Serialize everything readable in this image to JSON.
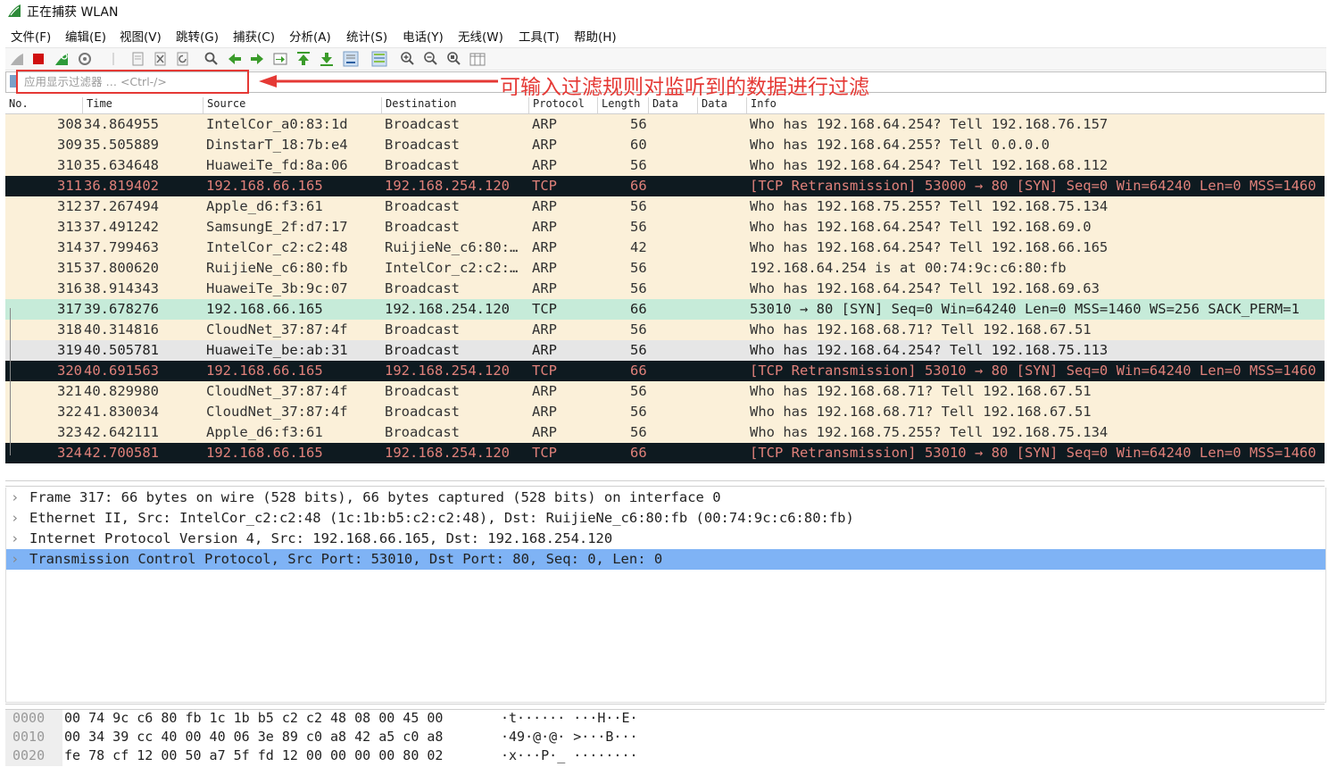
{
  "window": {
    "title": "正在捕获 WLAN"
  },
  "menu": [
    "文件(F)",
    "编辑(E)",
    "视图(V)",
    "跳转(G)",
    "捕获(C)",
    "分析(A)",
    "统计(S)",
    "电话(Y)",
    "无线(W)",
    "工具(T)",
    "帮助(H)"
  ],
  "filter": {
    "placeholder": "应用显示过滤器 … <Ctrl-/>"
  },
  "annotation": "可输入过滤规则对监听到的数据进行过滤",
  "columns": {
    "no": "No.",
    "time": "Time",
    "source": "Source",
    "destination": "Destination",
    "protocol": "Protocol",
    "length": "Length",
    "data1": "Data",
    "data2": "Data",
    "info": "Info"
  },
  "packets": [
    {
      "no": "308",
      "time": "34.864955",
      "src": "IntelCor_a0:83:1d",
      "dst": "Broadcast",
      "proto": "ARP",
      "len": "56",
      "info": "Who has 192.168.64.254? Tell 192.168.76.157",
      "style": "arp"
    },
    {
      "no": "309",
      "time": "35.505889",
      "src": "DinstarT_18:7b:e4",
      "dst": "Broadcast",
      "proto": "ARP",
      "len": "60",
      "info": "Who has 192.168.64.255? Tell 0.0.0.0",
      "style": "arp"
    },
    {
      "no": "310",
      "time": "35.634648",
      "src": "HuaweiTe_fd:8a:06",
      "dst": "Broadcast",
      "proto": "ARP",
      "len": "56",
      "info": "Who has 192.168.64.254? Tell 192.168.68.112",
      "style": "arp"
    },
    {
      "no": "311",
      "time": "36.819402",
      "src": "192.168.66.165",
      "dst": "192.168.254.120",
      "proto": "TCP",
      "len": "66",
      "info": "[TCP Retransmission] 53000 → 80 [SYN] Seq=0 Win=64240 Len=0 MSS=1460",
      "style": "tcpbad"
    },
    {
      "no": "312",
      "time": "37.267494",
      "src": "Apple_d6:f3:61",
      "dst": "Broadcast",
      "proto": "ARP",
      "len": "56",
      "info": "Who has 192.168.75.255? Tell 192.168.75.134",
      "style": "arp"
    },
    {
      "no": "313",
      "time": "37.491242",
      "src": "SamsungE_2f:d7:17",
      "dst": "Broadcast",
      "proto": "ARP",
      "len": "56",
      "info": "Who has 192.168.64.254? Tell 192.168.69.0",
      "style": "arp"
    },
    {
      "no": "314",
      "time": "37.799463",
      "src": "IntelCor_c2:c2:48",
      "dst": "RuijieNe_c6:80:…",
      "proto": "ARP",
      "len": "42",
      "info": "Who has 192.168.64.254? Tell 192.168.66.165",
      "style": "arp"
    },
    {
      "no": "315",
      "time": "37.800620",
      "src": "RuijieNe_c6:80:fb",
      "dst": "IntelCor_c2:c2:…",
      "proto": "ARP",
      "len": "56",
      "info": "192.168.64.254 is at 00:74:9c:c6:80:fb",
      "style": "arp"
    },
    {
      "no": "316",
      "time": "38.914343",
      "src": "HuaweiTe_3b:9c:07",
      "dst": "Broadcast",
      "proto": "ARP",
      "len": "56",
      "info": "Who has 192.168.64.254? Tell 192.168.69.63",
      "style": "arp"
    },
    {
      "no": "317",
      "time": "39.678276",
      "src": "192.168.66.165",
      "dst": "192.168.254.120",
      "proto": "TCP",
      "len": "66",
      "info": "53010 → 80 [SYN] Seq=0 Win=64240 Len=0 MSS=1460 WS=256 SACK_PERM=1",
      "style": "tcp"
    },
    {
      "no": "318",
      "time": "40.314816",
      "src": "CloudNet_37:87:4f",
      "dst": "Broadcast",
      "proto": "ARP",
      "len": "56",
      "info": "Who has 192.168.68.71? Tell 192.168.67.51",
      "style": "arp"
    },
    {
      "no": "319",
      "time": "40.505781",
      "src": "HuaweiTe_be:ab:31",
      "dst": "Broadcast",
      "proto": "ARP",
      "len": "56",
      "info": "Who has 192.168.64.254? Tell 192.168.75.113",
      "style": "grey"
    },
    {
      "no": "320",
      "time": "40.691563",
      "src": "192.168.66.165",
      "dst": "192.168.254.120",
      "proto": "TCP",
      "len": "66",
      "info": "[TCP Retransmission] 53010 → 80 [SYN] Seq=0 Win=64240 Len=0 MSS=1460",
      "style": "tcpbad"
    },
    {
      "no": "321",
      "time": "40.829980",
      "src": "CloudNet_37:87:4f",
      "dst": "Broadcast",
      "proto": "ARP",
      "len": "56",
      "info": "Who has 192.168.68.71? Tell 192.168.67.51",
      "style": "arp"
    },
    {
      "no": "322",
      "time": "41.830034",
      "src": "CloudNet_37:87:4f",
      "dst": "Broadcast",
      "proto": "ARP",
      "len": "56",
      "info": "Who has 192.168.68.71? Tell 192.168.67.51",
      "style": "arp"
    },
    {
      "no": "323",
      "time": "42.642111",
      "src": "Apple_d6:f3:61",
      "dst": "Broadcast",
      "proto": "ARP",
      "len": "56",
      "info": "Who has 192.168.75.255? Tell 192.168.75.134",
      "style": "arp"
    },
    {
      "no": "324",
      "time": "42.700581",
      "src": "192.168.66.165",
      "dst": "192.168.254.120",
      "proto": "TCP",
      "len": "66",
      "info": "[TCP Retransmission] 53010 → 80 [SYN] Seq=0 Win=64240 Len=0 MSS=1460",
      "style": "tcpbad"
    }
  ],
  "details": [
    {
      "text": "Frame 317: 66 bytes on wire (528 bits), 66 bytes captured (528 bits) on interface 0",
      "selected": false
    },
    {
      "text": "Ethernet II, Src: IntelCor_c2:c2:48 (1c:1b:b5:c2:c2:48), Dst: RuijieNe_c6:80:fb (00:74:9c:c6:80:fb)",
      "selected": false
    },
    {
      "text": "Internet Protocol Version 4, Src: 192.168.66.165, Dst: 192.168.254.120",
      "selected": false
    },
    {
      "text": "Transmission Control Protocol, Src Port: 53010, Dst Port: 80, Seq: 0, Len: 0",
      "selected": true
    }
  ],
  "bytes": [
    {
      "offset": "0000",
      "hex": "00 74 9c c6 80 fb 1c 1b  b5 c2 c2 48 08 00 45 00",
      "ascii": "·t······ ···H··E·"
    },
    {
      "offset": "0010",
      "hex": "00 34 39 cc 40 00 40 06  3e 89 c0 a8 42 a5 c0 a8",
      "ascii": "·49·@·@· >···B···"
    },
    {
      "offset": "0020",
      "hex": "fe 78 cf 12 00 50 a7 5f  fd 12 00 00 00 00 80 02",
      "ascii": "·x···P·_ ········"
    }
  ],
  "icons": [
    "shark-fin-icon",
    "stop-capture-icon",
    "restart-capture-icon",
    "capture-options-icon",
    "open-file-icon",
    "close-file-icon",
    "reload-icon",
    "find-icon",
    "back-icon",
    "forward-icon",
    "go-to-packet-icon",
    "first-packet-icon",
    "last-packet-icon",
    "autoscroll-icon",
    "colorize-icon",
    "zoom-in-icon",
    "zoom-out-icon",
    "normal-size-icon",
    "resize-columns-icon"
  ],
  "colors": {
    "arp": "#fbf0d9",
    "tcp": "#c6ebd9",
    "tcp_bad_bg": "#0e1a20",
    "tcp_bad_fg": "#e0817a",
    "selected_detail": "#7fb3f5",
    "annotation": "#e53935"
  }
}
